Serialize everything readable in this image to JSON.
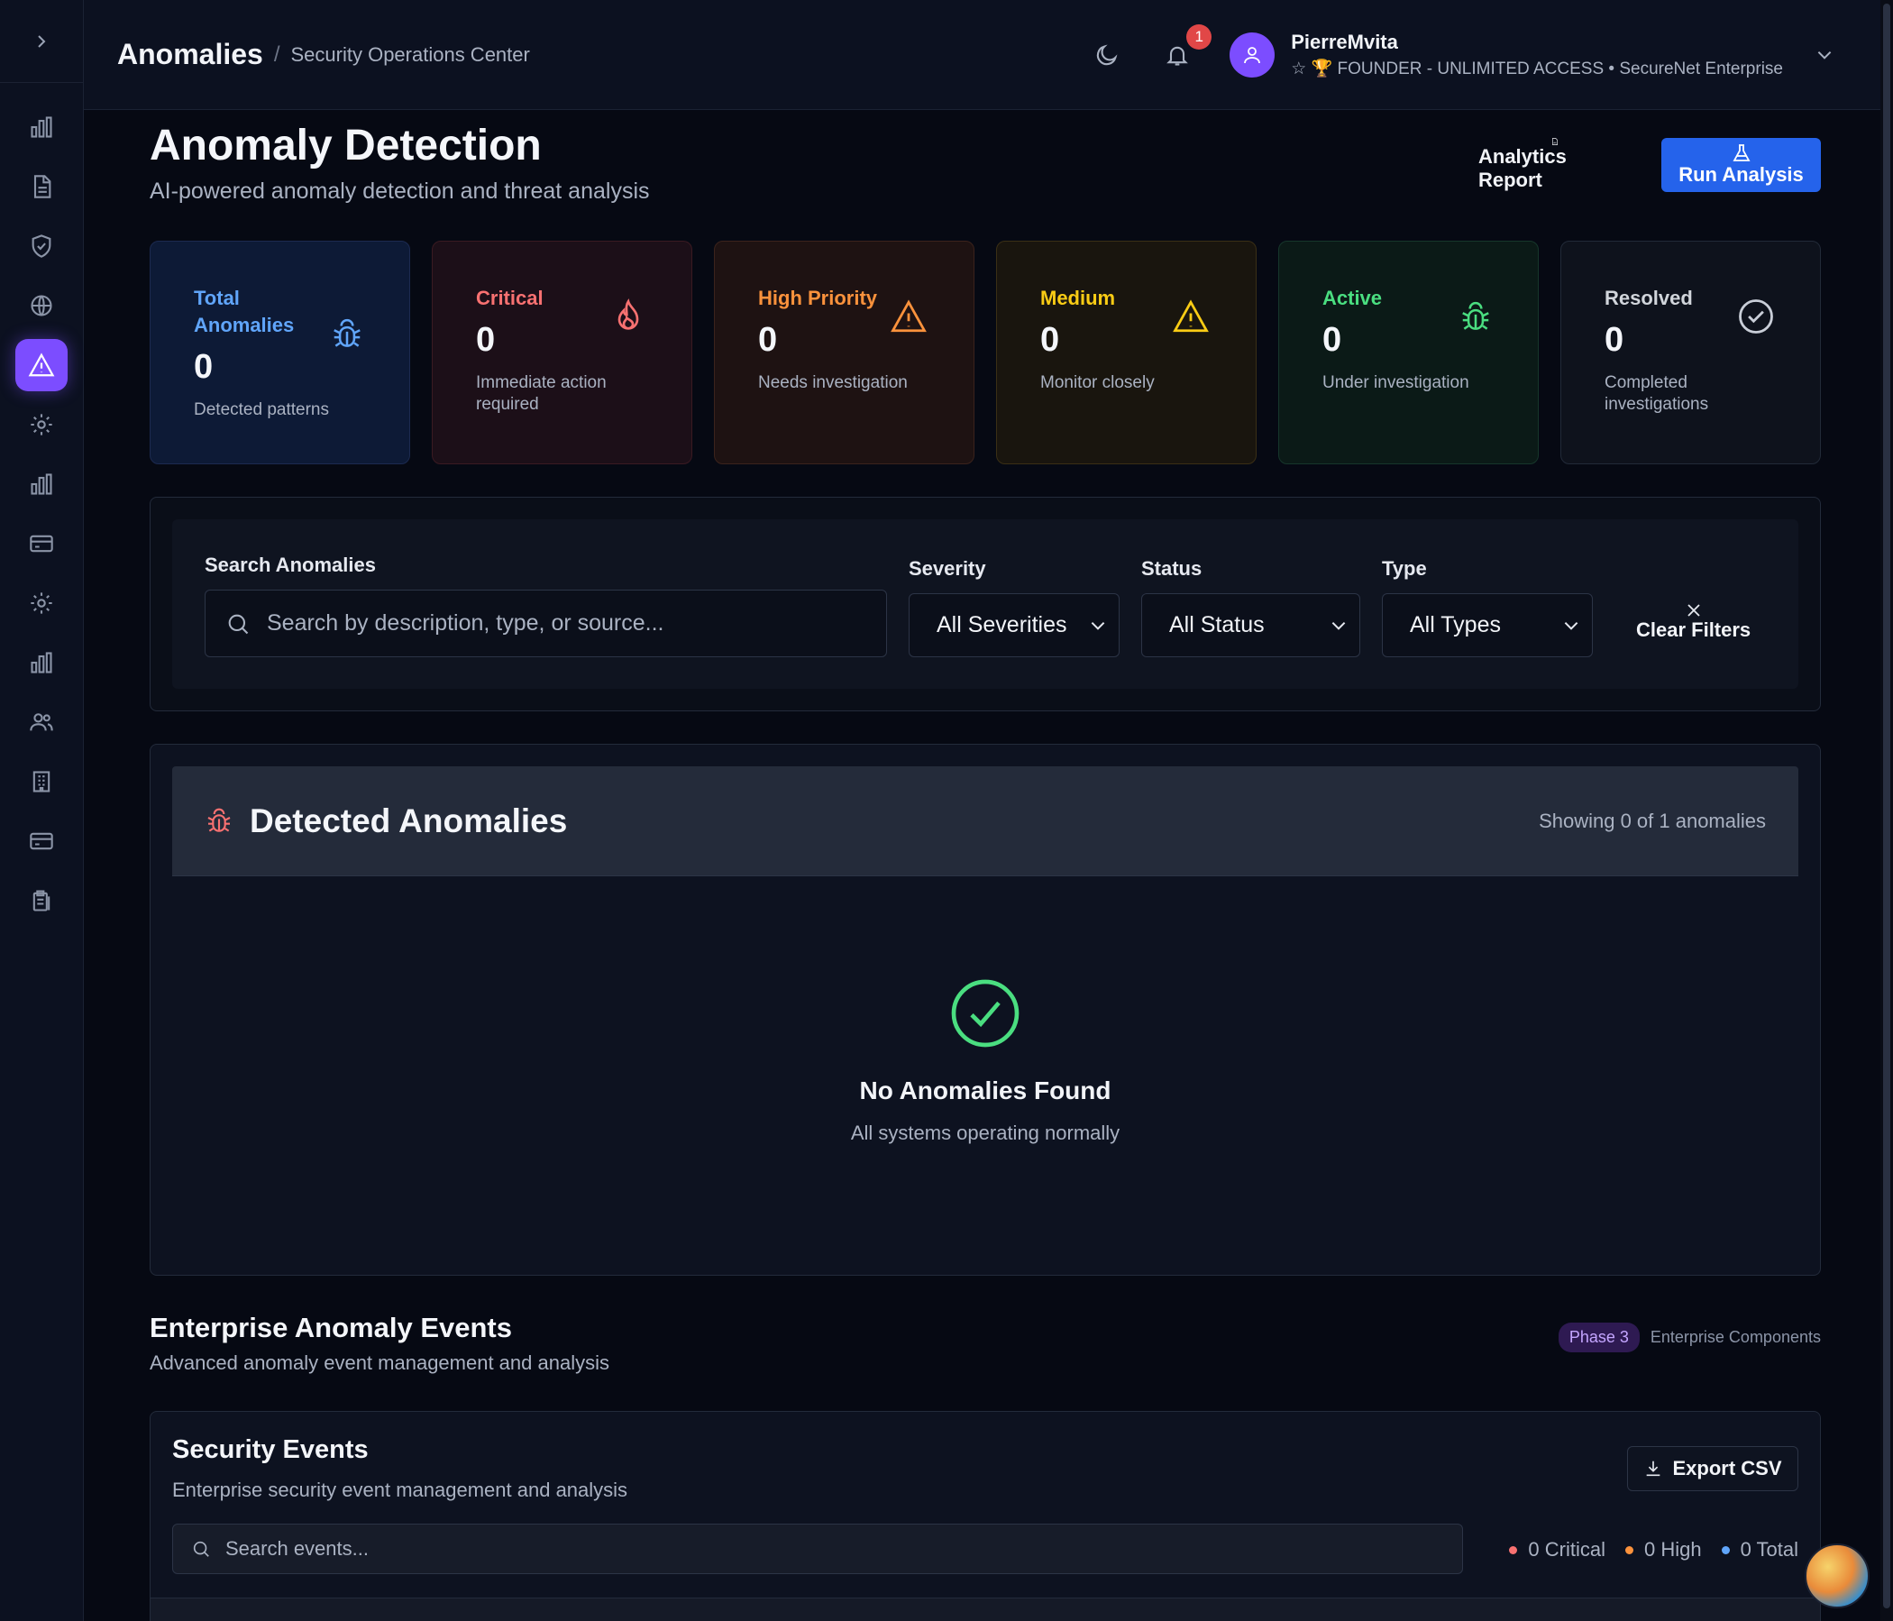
{
  "header": {
    "title": "Anomalies",
    "separator": "/",
    "subtitle": "Security Operations Center",
    "notification_count": "1",
    "user_name": "PierreMvita",
    "user_star": "☆",
    "user_trophy": "🏆",
    "user_role": "FOUNDER - UNLIMITED ACCESS",
    "user_bullet": "•",
    "user_org": "SecureNet Enterprise"
  },
  "sidebar": {
    "items": [
      {
        "icon": "bar-chart-icon"
      },
      {
        "icon": "document-icon"
      },
      {
        "icon": "shield-icon"
      },
      {
        "icon": "globe-icon"
      },
      {
        "icon": "alert-triangle-icon",
        "active": true
      },
      {
        "icon": "gear-icon"
      },
      {
        "icon": "bar-chart-icon"
      },
      {
        "icon": "card-icon"
      },
      {
        "icon": "gear-icon"
      },
      {
        "icon": "bar-chart-icon"
      },
      {
        "icon": "users-icon"
      },
      {
        "icon": "building-icon"
      },
      {
        "icon": "card-icon"
      },
      {
        "icon": "clipboard-icon"
      }
    ]
  },
  "page": {
    "title": "Anomaly Detection",
    "subtitle": "AI-powered anomaly detection and threat analysis",
    "report_label": "Analytics Report",
    "run_label": "Run Analysis"
  },
  "stats": {
    "total": {
      "label": "Total Anomalies",
      "value": "0",
      "desc": "Detected patterns"
    },
    "critical": {
      "label": "Critical",
      "value": "0",
      "desc": "Immediate action required"
    },
    "high": {
      "label": "High Priority",
      "value": "0",
      "desc": "Needs investigation"
    },
    "medium": {
      "label": "Medium",
      "value": "0",
      "desc": "Monitor closely"
    },
    "active": {
      "label": "Active",
      "value": "0",
      "desc": "Under investigation"
    },
    "resolved": {
      "label": "Resolved",
      "value": "0",
      "desc": "Completed investigations"
    }
  },
  "filters": {
    "search_label": "Search Anomalies",
    "search_placeholder": "Search by description, type, or source...",
    "severity_label": "Severity",
    "severity_value": "All Severities",
    "status_label": "Status",
    "status_value": "All Status",
    "type_label": "Type",
    "type_value": "All Types",
    "clear_label": "Clear Filters"
  },
  "detected": {
    "title": "Detected Anomalies",
    "count_text": "Showing 0 of 1 anomalies",
    "empty_title": "No Anomalies Found",
    "empty_sub": "All systems operating normally"
  },
  "enterprise": {
    "title": "Enterprise Anomaly Events",
    "subtitle": "Advanced anomaly event management and analysis",
    "phase_badge": "Phase 3",
    "components_label": "Enterprise Components"
  },
  "security_events": {
    "title": "Security Events",
    "subtitle": "Enterprise security event management and analysis",
    "export_label": "Export CSV",
    "search_placeholder": "Search events...",
    "critical_text": "0 Critical",
    "high_text": "0 High",
    "total_text": "0 Total"
  },
  "colors": {
    "accent": "#7c4dff",
    "primary_button": "#2563eb",
    "critical": "#f87171",
    "high": "#fb923c",
    "medium": "#facc15",
    "active": "#4ade80",
    "info": "#60a5fa"
  }
}
